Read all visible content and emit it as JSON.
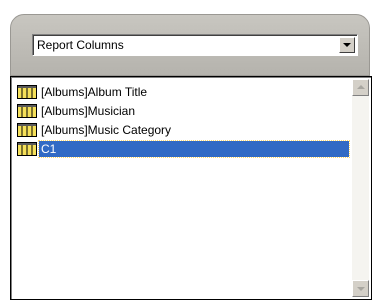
{
  "header": {
    "dropdown_value": "Report Columns"
  },
  "list": {
    "items": [
      {
        "label": "[Albums]Album Title",
        "icon": "table-column-icon",
        "selected": false
      },
      {
        "label": "[Albums]Musician",
        "icon": "table-column-icon",
        "selected": false
      },
      {
        "label": "[Albums]Music Category",
        "icon": "table-column-icon",
        "selected": false
      },
      {
        "label": "C1",
        "icon": "table-column-icon",
        "selected": true
      }
    ]
  },
  "colors": {
    "selection": "#316ac5",
    "header_bg": "#c8c6c0",
    "icon_yellow": "#f5e05a"
  }
}
